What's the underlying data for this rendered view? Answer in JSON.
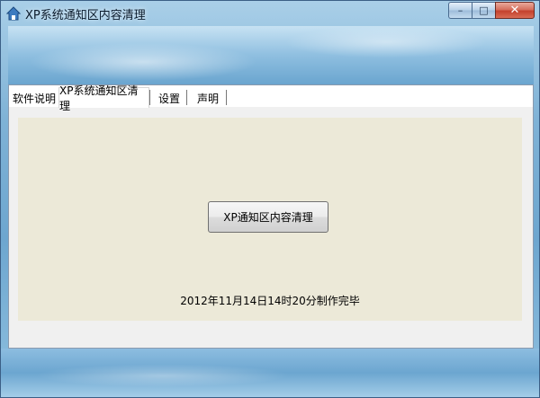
{
  "window": {
    "title": "XP系统通知区内容清理",
    "icon": "house-icon",
    "caption": {
      "minimize": "–",
      "maximize": "□",
      "close": "✕"
    }
  },
  "tabs": [
    {
      "label": "软件说明",
      "active": false
    },
    {
      "label": "XP系统通知区清理",
      "active": true
    },
    {
      "label": "设置",
      "active": false
    },
    {
      "label": "声明",
      "active": false
    }
  ],
  "panel": {
    "action_button": "XP通知区内容清理",
    "made_note": "2012年11月14日14时20分制作完毕"
  },
  "colors": {
    "panel_bg": "#ece9d8",
    "frame_blue": "#6da6cf",
    "close_red": "#c4412d"
  }
}
